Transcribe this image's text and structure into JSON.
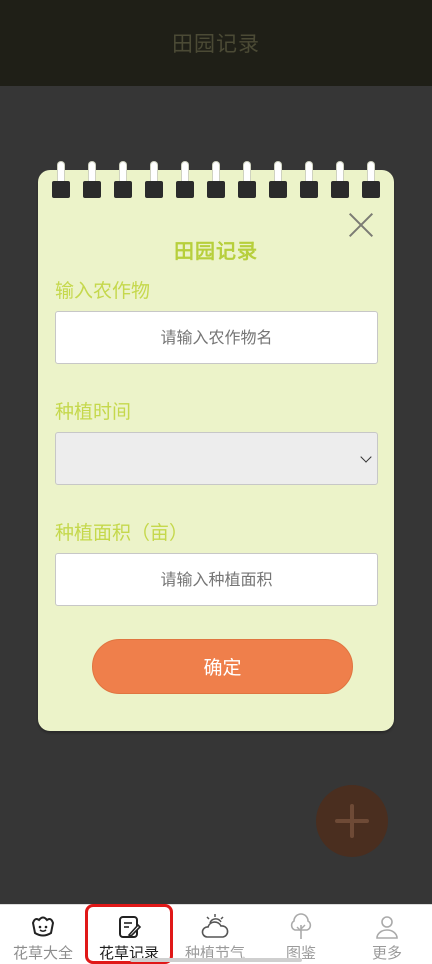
{
  "header": {
    "title": "田园记录"
  },
  "modal": {
    "title": "田园记录",
    "crop_label": "输入农作物",
    "crop_placeholder": "请输入农作物名",
    "time_label": "种植时间",
    "time_value": "",
    "area_label": "种植面积（亩）",
    "area_placeholder": "请输入种植面积",
    "confirm_label": "确定"
  },
  "tabbar": {
    "items": [
      {
        "label": "花草大全",
        "icon": "flower-pot-icon"
      },
      {
        "label": "花草记录",
        "icon": "edit-note-icon"
      },
      {
        "label": "种植节气",
        "icon": "sun-cloud-icon"
      },
      {
        "label": "图鉴",
        "icon": "tree-icon"
      },
      {
        "label": "更多",
        "icon": "user-icon"
      }
    ],
    "active_index": 1
  },
  "colors": {
    "accent_label": "#c5d84c",
    "confirm_button": "#ef7f4b",
    "modal_background": "#ecf3c9",
    "active_tab_outline": "#e01818"
  }
}
